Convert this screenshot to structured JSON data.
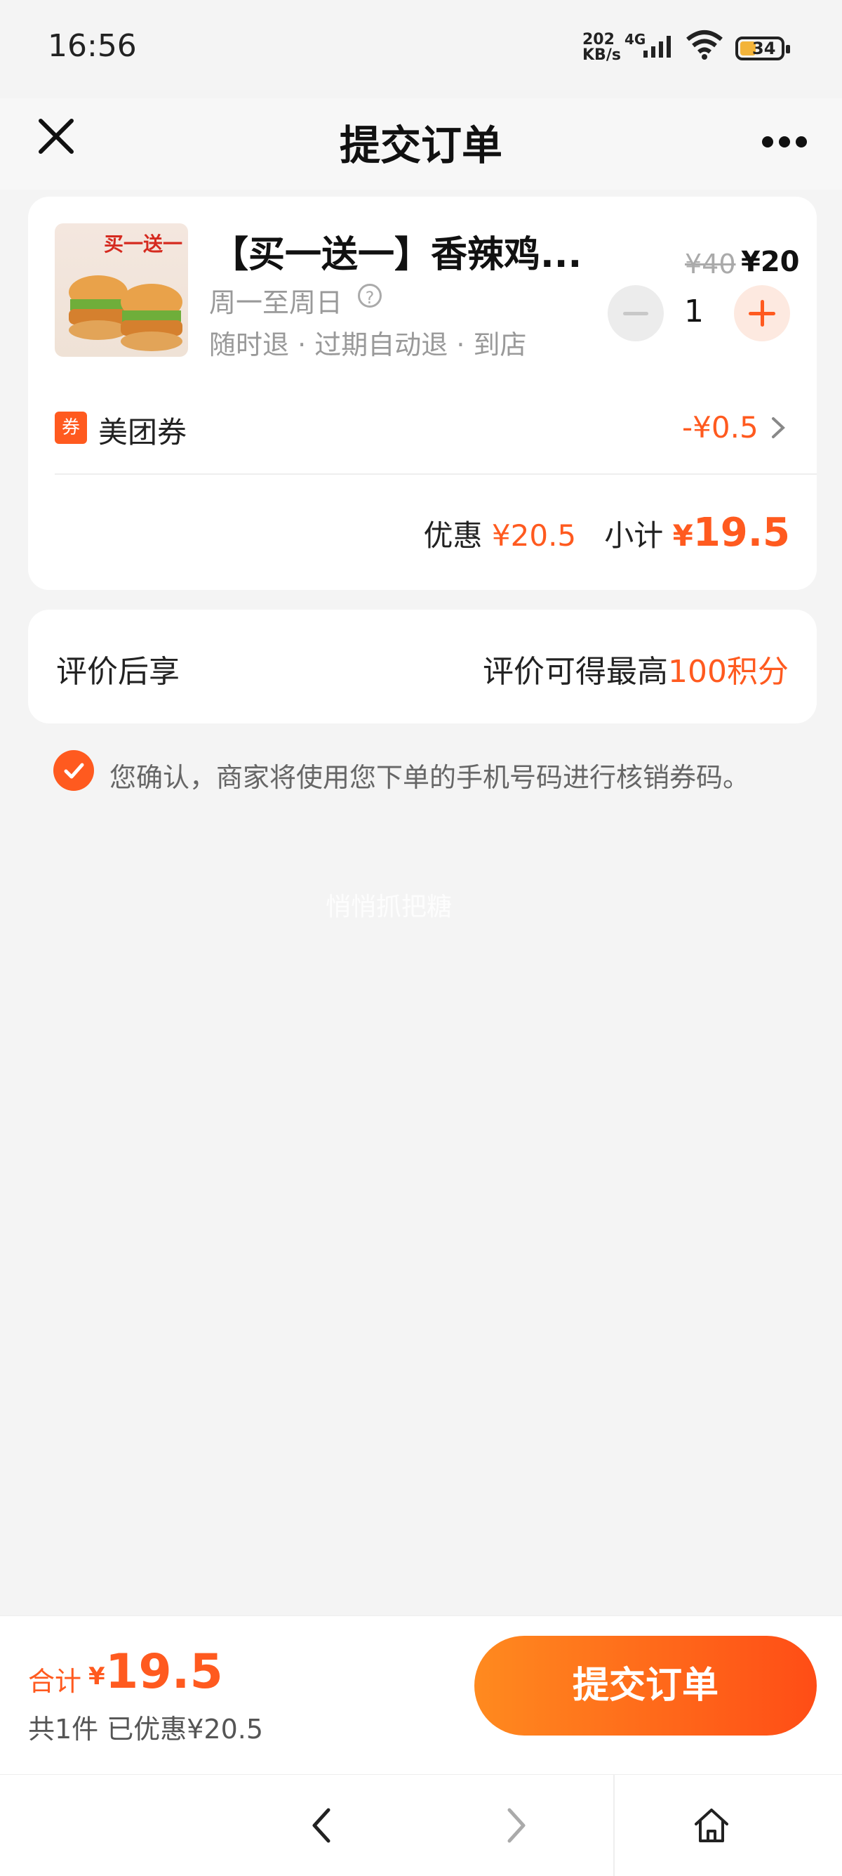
{
  "status_bar": {
    "time": "16:56",
    "speed": "202",
    "speed_unit": "KB/s",
    "network": "4G",
    "battery": "34"
  },
  "nav": {
    "title": "提交订单"
  },
  "product": {
    "image_promo_text": "买一送一",
    "title": "【买一送一】香辣鸡...",
    "validity": "周一至周日",
    "tags": "随时退 · 过期自动退 · 到店",
    "original_price": "¥40",
    "price": "¥20",
    "quantity": "1"
  },
  "coupon": {
    "icon_char": "券",
    "label": "美团券",
    "value": "-¥0.5"
  },
  "summary": {
    "discount_label": "优惠",
    "discount_value": "¥20.5",
    "subtotal_label": "小计",
    "subtotal_currency": "¥",
    "subtotal_value": "19.5"
  },
  "review": {
    "left_label": "评价后享",
    "right_prefix": "评价可得最高",
    "right_highlight": "100积分"
  },
  "confirm": {
    "text": "您确认，商家将使用您下单的手机号码进行核销券码。"
  },
  "watermark": "悄悄抓把糖",
  "bottom_bar": {
    "total_label": "合计",
    "total_currency": "¥",
    "total_value": "19.5",
    "sub_text": "共1件  已优惠¥20.5",
    "submit_label": "提交订单"
  },
  "colors": {
    "accent": "#ff5a1f",
    "background": "#f4f4f4"
  }
}
